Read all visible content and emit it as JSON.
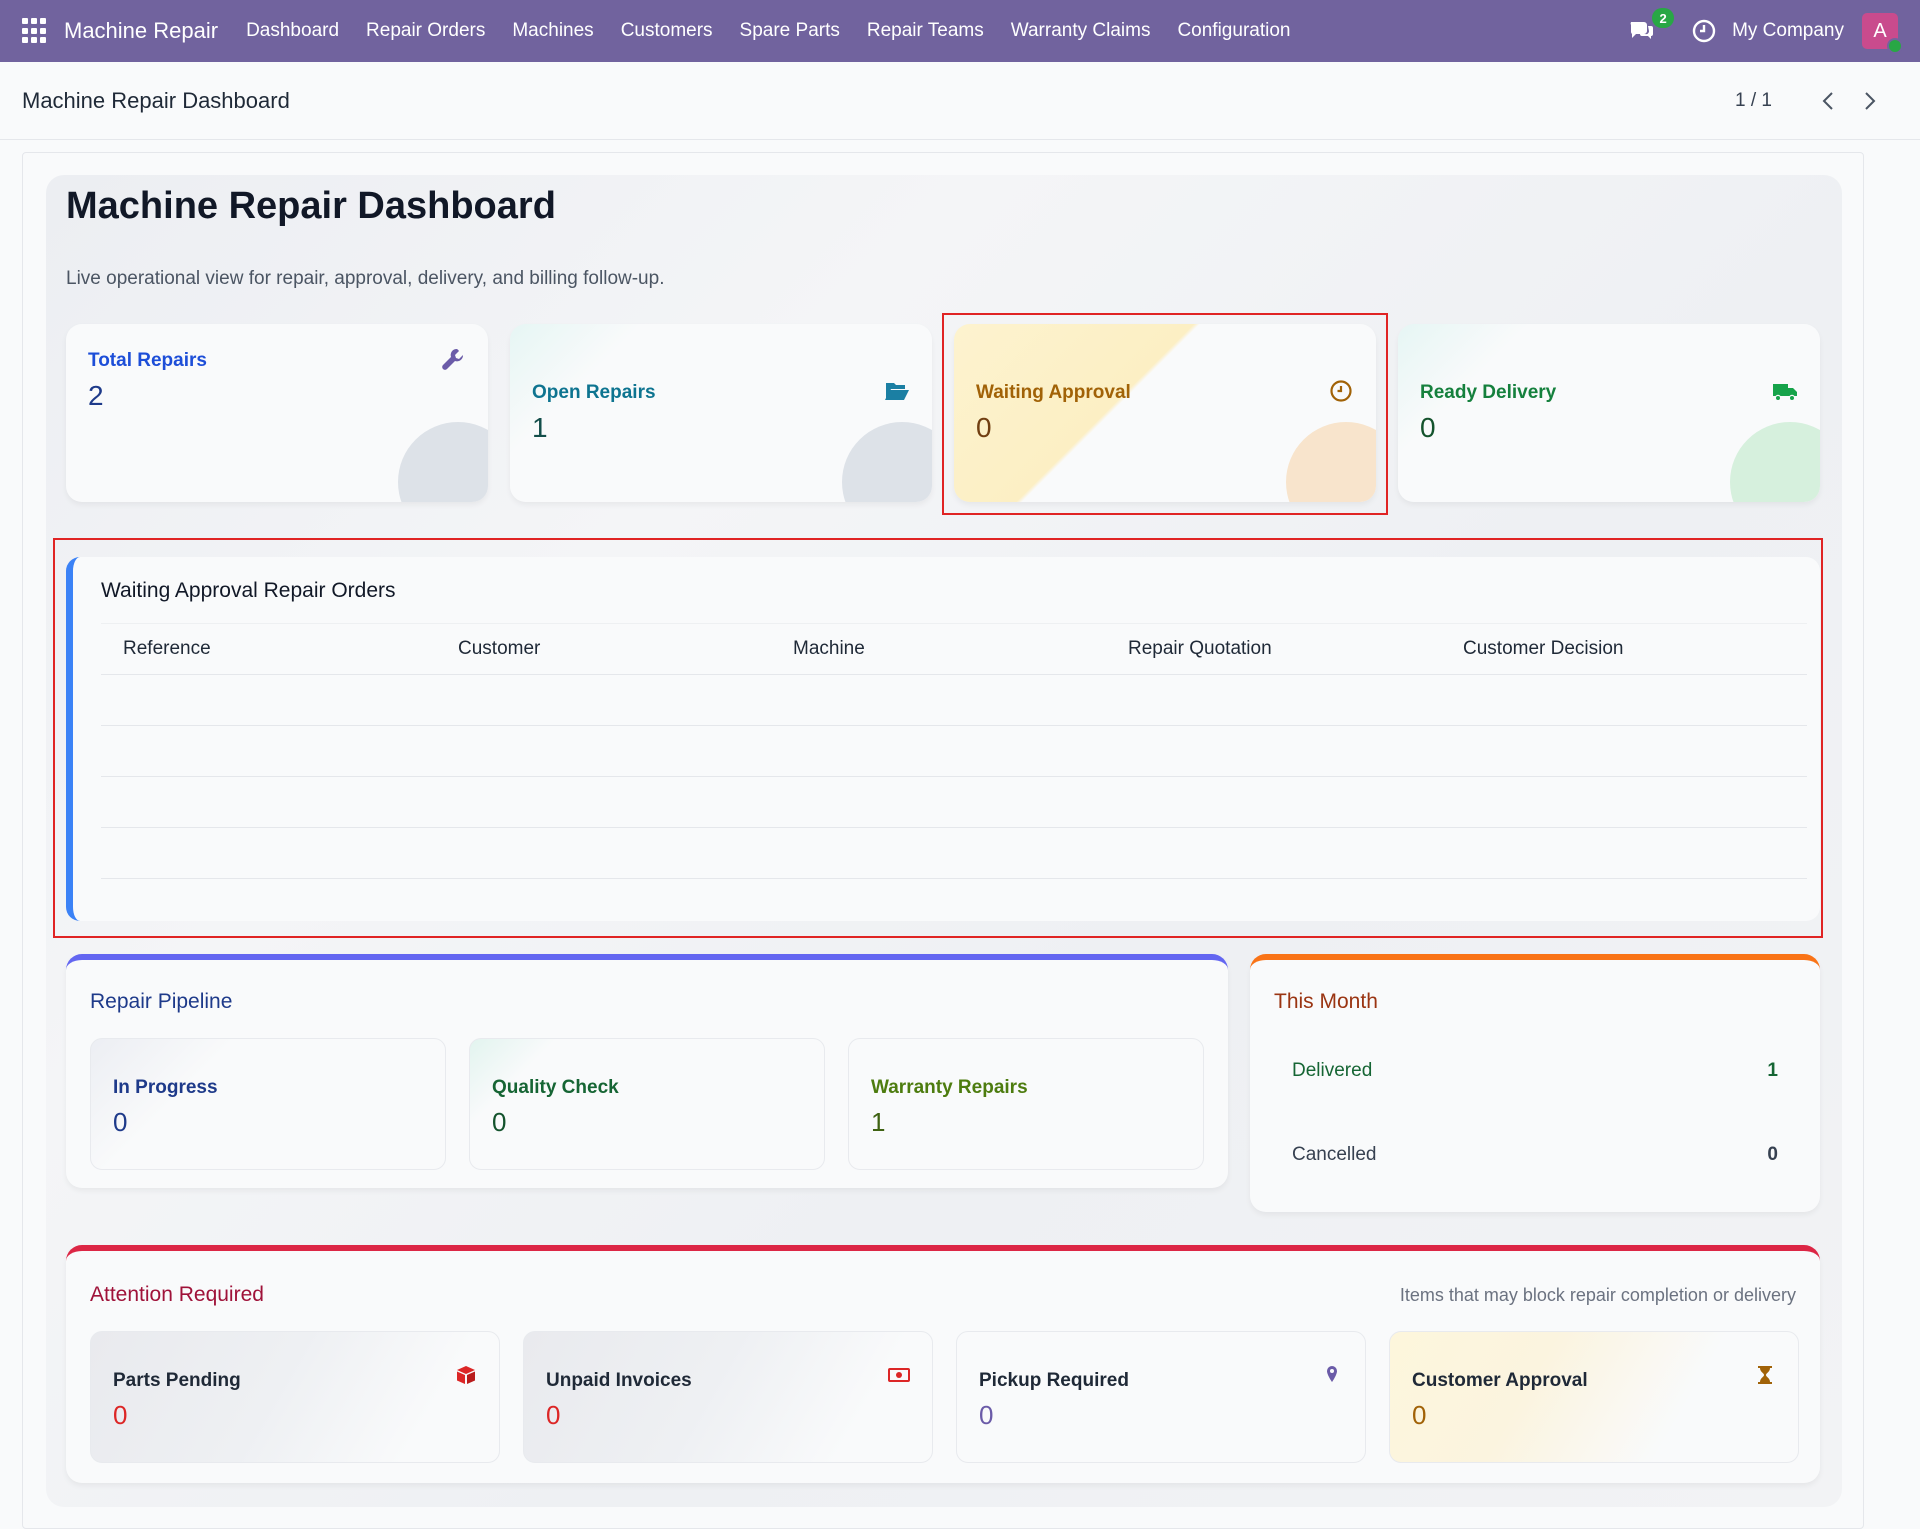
{
  "navbar": {
    "brand": "Machine Repair",
    "menu": [
      "Dashboard",
      "Repair Orders",
      "Machines",
      "Customers",
      "Spare Parts",
      "Repair Teams",
      "Warranty Claims",
      "Configuration"
    ],
    "chat_count": "2",
    "company": "My Company",
    "avatar_letter": "A"
  },
  "control_panel": {
    "breadcrumb": "Machine Repair Dashboard",
    "pager": "1 / 1"
  },
  "dashboard": {
    "title": "Machine Repair Dashboard",
    "subtitle": "Live operational view for repair, approval, delivery, and billing follow-up.",
    "kpis": [
      {
        "label": "Total Repairs",
        "value": "2",
        "icon": "wrench-icon",
        "color": "#1d4ed8"
      },
      {
        "label": "Open Repairs",
        "value": "1",
        "icon": "folder-open-icon",
        "color": "#0e7490"
      },
      {
        "label": "Waiting Approval",
        "value": "0",
        "icon": "clock-icon",
        "color": "#a16207"
      },
      {
        "label": "Ready Delivery",
        "value": "0",
        "icon": "truck-icon",
        "color": "#15803d"
      }
    ],
    "waiting_table": {
      "title": "Waiting Approval Repair Orders",
      "columns": [
        "Reference",
        "Customer",
        "Machine",
        "Repair Quotation",
        "Customer Decision"
      ]
    },
    "pipeline": {
      "title": "Repair Pipeline",
      "items": [
        {
          "label": "In Progress",
          "value": "0",
          "color": "#1e3a8a"
        },
        {
          "label": "Quality Check",
          "value": "0",
          "color": "#166534"
        },
        {
          "label": "Warranty Repairs",
          "value": "1",
          "color": "#4d7c0f"
        }
      ]
    },
    "this_month": {
      "title": "This Month",
      "rows": [
        {
          "label": "Delivered",
          "value": "1"
        },
        {
          "label": "Cancelled",
          "value": "0"
        }
      ]
    },
    "attention": {
      "title": "Attention Required",
      "subtitle": "Items that may block repair completion or delivery",
      "items": [
        {
          "label": "Parts Pending",
          "value": "0",
          "icon": "box-icon",
          "color": "#dc2626"
        },
        {
          "label": "Unpaid Invoices",
          "value": "0",
          "icon": "money-icon",
          "color": "#dc2626"
        },
        {
          "label": "Pickup Required",
          "value": "0",
          "icon": "map-pin-icon",
          "color": "#6b5ba8"
        },
        {
          "label": "Customer Approval",
          "value": "0",
          "icon": "hourglass-icon",
          "color": "#a16207"
        }
      ]
    }
  }
}
